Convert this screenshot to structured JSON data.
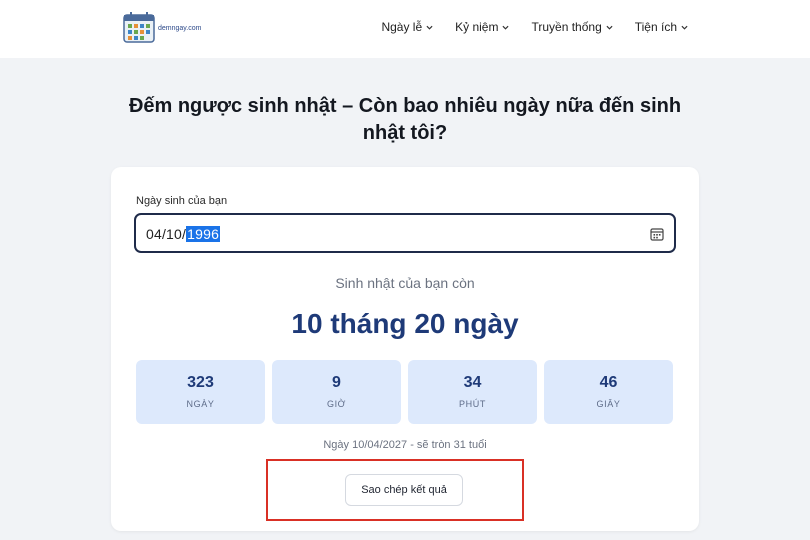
{
  "site": {
    "logo_text": "demngay.com"
  },
  "nav": {
    "items": [
      {
        "label": "Ngày lễ"
      },
      {
        "label": "Kỷ niệm"
      },
      {
        "label": "Truyền thống"
      },
      {
        "label": "Tiện ích"
      }
    ]
  },
  "page": {
    "title": "Đếm ngược sinh nhật – Còn bao nhiêu ngày nữa đến sinh nhật tôi?"
  },
  "form": {
    "dob_label": "Ngày sinh của bạn",
    "dob_value_prefix": "04/10/",
    "dob_value_year": "1996"
  },
  "result": {
    "remain_label": "Sinh nhật của bạn còn",
    "big_count": "10 tháng 20 ngày",
    "units": [
      {
        "value": "323",
        "label": "NGÀY"
      },
      {
        "value": "9",
        "label": "GIỜ"
      },
      {
        "value": "34",
        "label": "PHÚT"
      },
      {
        "value": "46",
        "label": "GIÂY"
      }
    ],
    "info_line": "Ngày 10/04/2027 - sẽ tròn 31 tuổi",
    "copy_button": "Sao chép kết quả"
  },
  "colors": {
    "accent": "#1e3a78",
    "box_bg": "#dde9fc",
    "highlight": "#d93025",
    "selection": "#1a73e8"
  }
}
